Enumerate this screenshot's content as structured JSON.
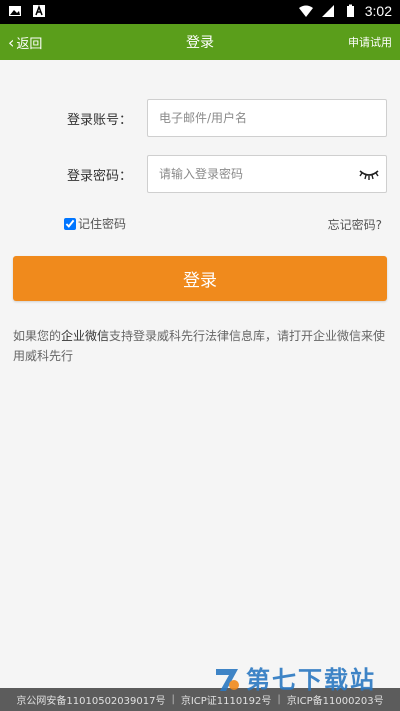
{
  "statusbar": {
    "time": "3:02"
  },
  "navbar": {
    "back_label": "返回",
    "title": "登录",
    "right_label": "申请试用"
  },
  "form": {
    "account_label": "登录账号：",
    "account_placeholder": "电子邮件/用户名",
    "password_label": "登录密码：",
    "password_placeholder": "请输入登录密码",
    "remember_label": "记住密码",
    "forgot_label": "忘记密码?",
    "submit_label": "登录"
  },
  "notice": {
    "prefix": "如果您的",
    "highlight": "企业微信",
    "suffix": "支持登录威科先行法律信息库，请打开企业微信来使用威科先行"
  },
  "footer": {
    "beian": "京公网安备11010502039017号",
    "icp_license": "京ICP证1110192号",
    "icp_record": "京ICP备11000203号"
  },
  "watermark": {
    "text": "第七下载站"
  },
  "colors": {
    "navbar": "#5a9e1b",
    "button": "#f08a1c",
    "footer": "#5c5c5c"
  },
  "icons": {
    "eye": "eye-closed-icon",
    "back": "chevron-left-icon"
  }
}
